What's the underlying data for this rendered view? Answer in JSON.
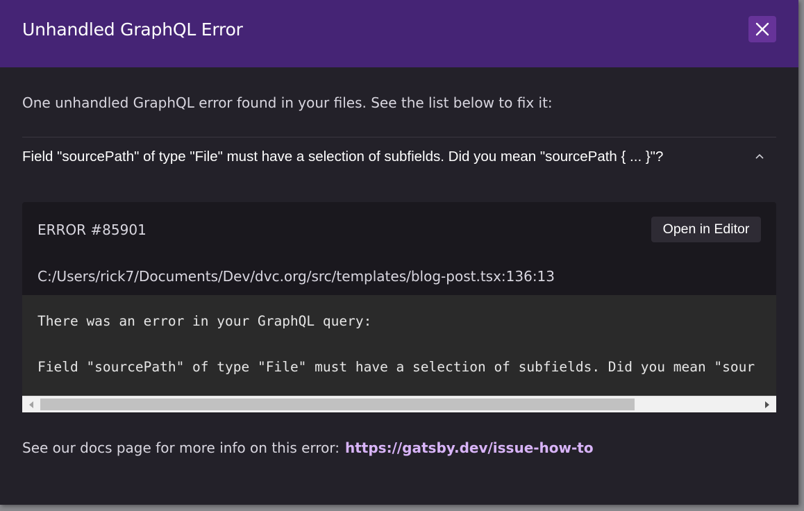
{
  "header": {
    "title": "Unhandled GraphQL Error",
    "close_icon": "close-icon"
  },
  "intro": "One unhandled GraphQL error found in your files. See the list below to fix it:",
  "error": {
    "summary": "Field \"sourcePath\" of type \"File\" must have a selection of subfields. Did you mean \"sourcePath { ... }\"?",
    "toggle_icon": "chevron-up-icon",
    "code": "ERROR #85901",
    "open_editor_label": "Open in Editor",
    "file_path": "C:/Users/rick7/Documents/Dev/dvc.org/src/templates/blog-post.tsx:136:13",
    "code_lines": [
      "There was an error in your GraphQL query:",
      "",
      "Field \"sourcePath\" of type \"File\" must have a selection of subfields. Did you mean \"sour"
    ]
  },
  "docs": {
    "text": "See our docs page for more info on this error:",
    "link_label": "https://gatsby.dev/issue-how-to"
  },
  "colors": {
    "header_bg": "#452475",
    "close_bg": "#663399",
    "panel_bg": "#232129",
    "link": "#d8b4f8"
  }
}
